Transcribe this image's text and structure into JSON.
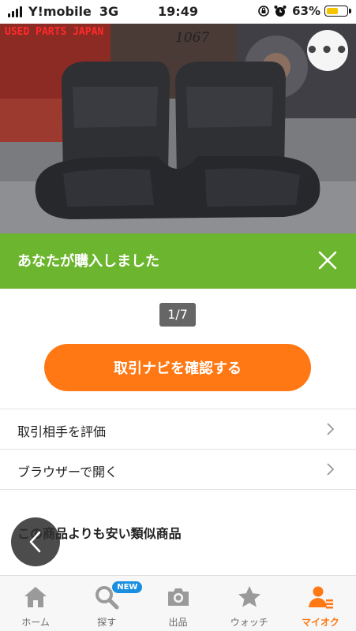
{
  "status_bar": {
    "carrier": "Y!mobile",
    "network": "3G",
    "time": "19:49",
    "battery_percent": "63%",
    "battery_level": 0.63
  },
  "photo": {
    "watermark": "USED PARTS JAPAN",
    "handwritten_number": "1067"
  },
  "banner": {
    "message": "あなたが購入しました"
  },
  "page_indicator": "1/7",
  "cta_label": "取引ナビを確認する",
  "menu": [
    {
      "label": "取引相手を評価"
    },
    {
      "label": "ブラウザーで開く"
    }
  ],
  "section_title": "この商品よりも安い類似商品",
  "tabs": [
    {
      "label": "ホーム",
      "icon": "home-icon"
    },
    {
      "label": "探す",
      "icon": "search-icon",
      "badge": "NEW"
    },
    {
      "label": "出品",
      "icon": "camera-icon"
    },
    {
      "label": "ウォッチ",
      "icon": "star-icon"
    },
    {
      "label": "マイオク",
      "icon": "profile-icon",
      "active": true
    }
  ],
  "colors": {
    "accent_orange": "#ff7814",
    "banner_green": "#6cb52e",
    "badge_blue": "#1a8fdf",
    "battery_yellow": "#f5c500"
  }
}
